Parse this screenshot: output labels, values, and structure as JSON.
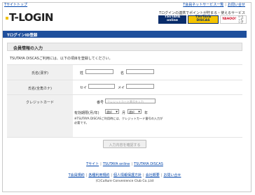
{
  "header": {
    "top_left_link": "Tサイトトップ",
    "top_right_links": [
      "T会員ネットサービス一覧",
      "お問い合せ"
    ],
    "logo_text": "T-LOGIN",
    "tagline": "Tログインの連携でポイントが貯まる・使えるサービス",
    "partners": [
      {
        "name": "TSUTAYA online",
        "line1": "TSUTAYA",
        "line2": "online"
      },
      {
        "name": "TSUTAYA DISCAS",
        "line1": "TSUTAYA",
        "line2": "DISCAS"
      },
      {
        "name": "Yahoo! ショッピング",
        "line1": "YAHOO!",
        "line2": "ショッピング"
      }
    ]
  },
  "title_bar": "TログインID登録",
  "section_title": "会員情報の入力",
  "intro": "TSUTAYA DISCASご利用には、以下の項目を登録してください。",
  "form": {
    "name_kanji": {
      "label": "氏名(漢字)",
      "last": "姓",
      "first": "名"
    },
    "name_kana": {
      "label": "氏名(全角カナ)",
      "last": "セイ",
      "first": "メイ"
    },
    "card": {
      "label": "クレジットカード",
      "number_label": "番号",
      "number_placeholder": "クレジットカード番号を入力",
      "expiry_label": "有効期限(月/年)",
      "month_value": "選択",
      "month_unit": "月",
      "year_value": "選択",
      "year_unit": "年",
      "note": "※TSUTAYA DISCASご利用時には、クレジットカード番号の入力が必要です。"
    }
  },
  "confirm_button": "入力内容を確認する",
  "mid_links": [
    "Tサイト",
    "TSUTAYA online",
    "TSUTAYA DISCAS"
  ],
  "bottom_links": [
    "T会員規約",
    "各種利用規約",
    "個人情報保護方針",
    "会社概要",
    "お問い合せ"
  ],
  "copyright": "(C)Culture Convenience Club Co.,Ltd"
}
